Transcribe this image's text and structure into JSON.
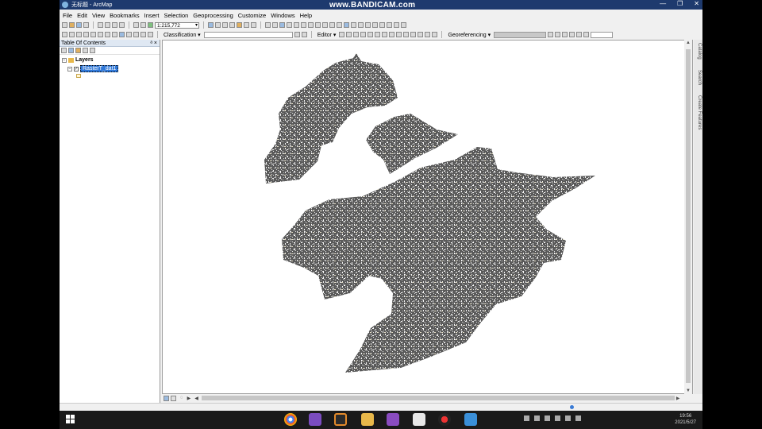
{
  "window": {
    "title": "无标题 - ArcMap",
    "watermark": "www.BANDICAM.com",
    "controls": [
      "—",
      "❐",
      "✕"
    ]
  },
  "menu": [
    "File",
    "Edit",
    "View",
    "Bookmarks",
    "Insert",
    "Selection",
    "Geoprocessing",
    "Customize",
    "Windows",
    "Help"
  ],
  "toolbar": {
    "scale": "1:215,772",
    "classification_label": "Classification ▾",
    "editor_label": "Editor ▾",
    "georeferencing_label": "Georeferencing ▾"
  },
  "toc": {
    "title": "Table Of Contents",
    "pin_close": "ᵃ ×",
    "root": "Layers",
    "layer": "RasterT_dat1"
  },
  "sidetabs": [
    "Catalog",
    "Search",
    "Create Features"
  ],
  "taskbar": {
    "time": "19:56",
    "date": "2021/5/27"
  },
  "colors": {
    "title_bar": "#1e3a6e",
    "selected_layer": "#3078d8",
    "raster_fill": "#5a5a5a",
    "map_background": "#ffffff"
  }
}
